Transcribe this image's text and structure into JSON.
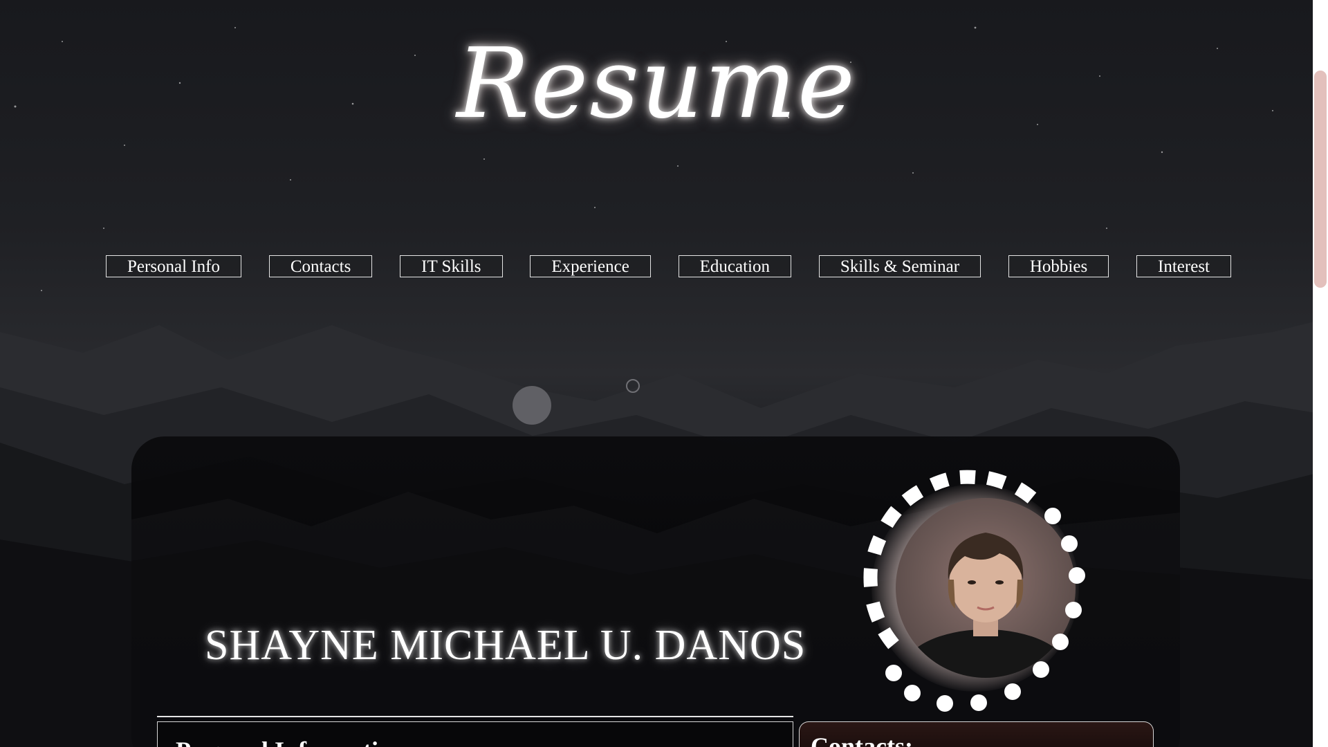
{
  "page": {
    "title": "Resume"
  },
  "nav": {
    "items": [
      {
        "label": "Personal Info"
      },
      {
        "label": "Contacts"
      },
      {
        "label": "IT Skills"
      },
      {
        "label": "Experience"
      },
      {
        "label": "Education"
      },
      {
        "label": "Skills & Seminar"
      },
      {
        "label": "Hobbies"
      },
      {
        "label": "Interest"
      }
    ]
  },
  "profile": {
    "name": "SHAYNE MICHAEL U. DANOS",
    "photo_icon": "person-portrait"
  },
  "sections": {
    "personal_info_heading": "Personal Information",
    "contacts_heading": "Contacts:"
  },
  "colors": {
    "accent_scroll": "#e3c0bc",
    "text": "#ffffff",
    "background": "#1d1e22"
  }
}
